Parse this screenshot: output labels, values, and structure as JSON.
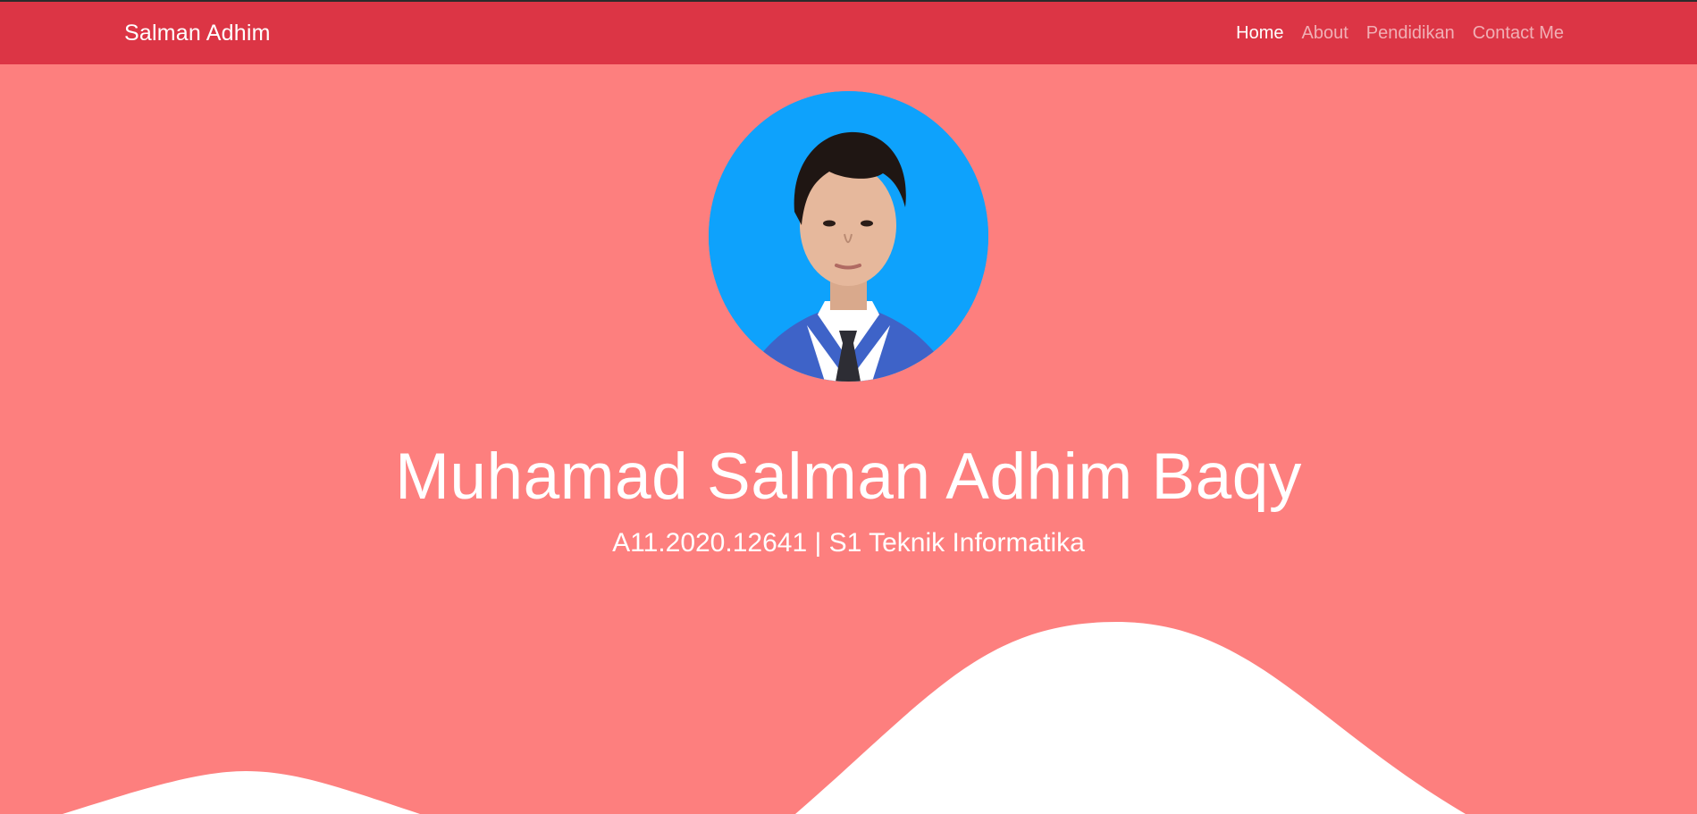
{
  "navbar": {
    "brand": "Salman Adhim",
    "links": [
      {
        "label": "Home",
        "active": true
      },
      {
        "label": "About",
        "active": false
      },
      {
        "label": "Pendidikan",
        "active": false
      },
      {
        "label": "Contact Me",
        "active": false
      }
    ]
  },
  "hero": {
    "name": "Muhamad Salman Adhim Baqy",
    "subtitle": "A11.2020.12641 | S1 Teknik Informatika"
  },
  "colors": {
    "navbar_bg": "#dc3545",
    "hero_bg": "#fd7f7e",
    "avatar_bg": "#0ea2fc",
    "wave": "#ffffff"
  }
}
